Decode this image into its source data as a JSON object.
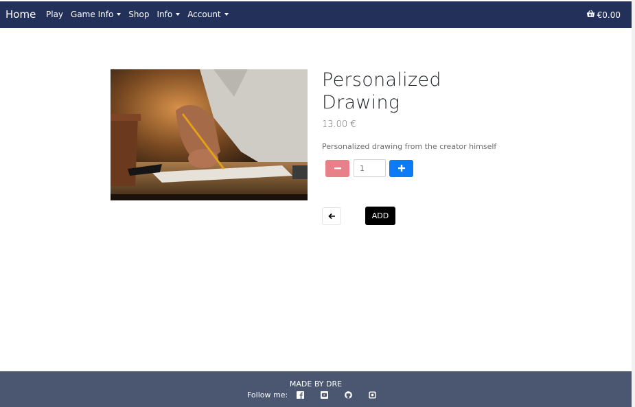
{
  "navbar": {
    "brand": "Home",
    "links": [
      {
        "label": "Play",
        "dropdown": false
      },
      {
        "label": "Game Info",
        "dropdown": true
      },
      {
        "label": "Shop",
        "dropdown": false
      },
      {
        "label": "Info",
        "dropdown": true
      },
      {
        "label": "Account",
        "dropdown": true
      }
    ],
    "cart_total": "€0.00",
    "cart_icon": "basket-icon"
  },
  "product": {
    "image_icon": "drawing-photo",
    "title": "Personalized Drawing",
    "price": "13.00 €",
    "description": "Personalized drawing from the creator himself",
    "quantity": "1",
    "add_label": "ADD",
    "back_icon": "arrow-left-icon"
  },
  "footer": {
    "credit": "MADE BY DRE",
    "follow_label": "Follow me:",
    "social_icons": [
      "facebook-icon",
      "youtube-icon",
      "github-icon",
      "instagram-icon"
    ]
  },
  "colors": {
    "navbar_bg": "#22305a",
    "footer_bg": "#4b5670",
    "minus_button": "#e8808a",
    "plus_button": "#0d7bf5",
    "add_button": "#000000"
  }
}
